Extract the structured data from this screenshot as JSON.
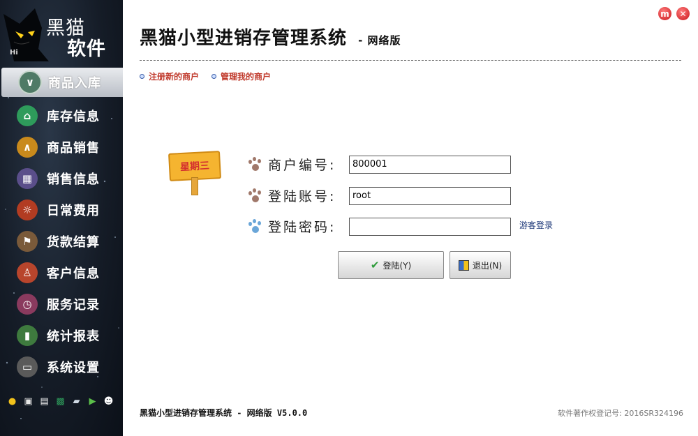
{
  "app": {
    "title": "黑猫小型进销存管理系统",
    "title_suffix": "- 网络版",
    "logo_line1": "黑猫",
    "logo_line2": "软件",
    "logo_hi": "Hi"
  },
  "window_controls": {
    "minimize_symbol": "m",
    "close_symbol": "✕"
  },
  "sidebar": {
    "items": [
      {
        "label": "商品入库",
        "icon": "down-arrow-icon",
        "color": "#4f7a66",
        "active": true
      },
      {
        "label": "库存信息",
        "icon": "home-icon",
        "color": "#2e9b5b",
        "active": false
      },
      {
        "label": "商品销售",
        "icon": "up-arrow-icon",
        "color": "#c98a1c",
        "active": false
      },
      {
        "label": "销售信息",
        "icon": "calculator-icon",
        "color": "#5a4e8a",
        "active": false
      },
      {
        "label": "日常费用",
        "icon": "sun-icon",
        "color": "#b23c22",
        "active": false
      },
      {
        "label": "货款结算",
        "icon": "flag-icon",
        "color": "#7a5a3a",
        "active": false
      },
      {
        "label": "客户信息",
        "icon": "user-icon",
        "color": "#b8452c",
        "active": false
      },
      {
        "label": "服务记录",
        "icon": "clock-icon",
        "color": "#8a3a5e",
        "active": false
      },
      {
        "label": "统计报表",
        "icon": "bars-icon",
        "color": "#3e7a3e",
        "active": false
      },
      {
        "label": "系统设置",
        "icon": "monitor-icon",
        "color": "#5a5a5a",
        "active": false
      }
    ],
    "toolbar_icons": [
      "coins-icon",
      "window-icon",
      "calendar-icon",
      "excel-icon",
      "chart-icon",
      "run-icon",
      "qq-icon"
    ]
  },
  "links": {
    "register": "注册新的商户",
    "manage": "管理我的商户"
  },
  "sign": {
    "weekday": "星期三"
  },
  "form": {
    "merchant_label": "商户编号:",
    "merchant_value": "800001",
    "account_label": "登陆账号:",
    "account_value": "root",
    "password_label": "登陆密码:",
    "password_value": "",
    "guest_login": "游客登录"
  },
  "buttons": {
    "login": "登陆(Y)",
    "exit": "退出(N)"
  },
  "footer": {
    "product": "黑猫小型进销存管理系统 - 网络版 V5.0.0",
    "copyright": "软件著作权登记号: 2016SR324196"
  },
  "colors": {
    "link_red": "#c0392b",
    "sidebar_bg": "#151c27",
    "paw_brown": "#a0786a",
    "paw_blue": "#6aa6d8"
  }
}
